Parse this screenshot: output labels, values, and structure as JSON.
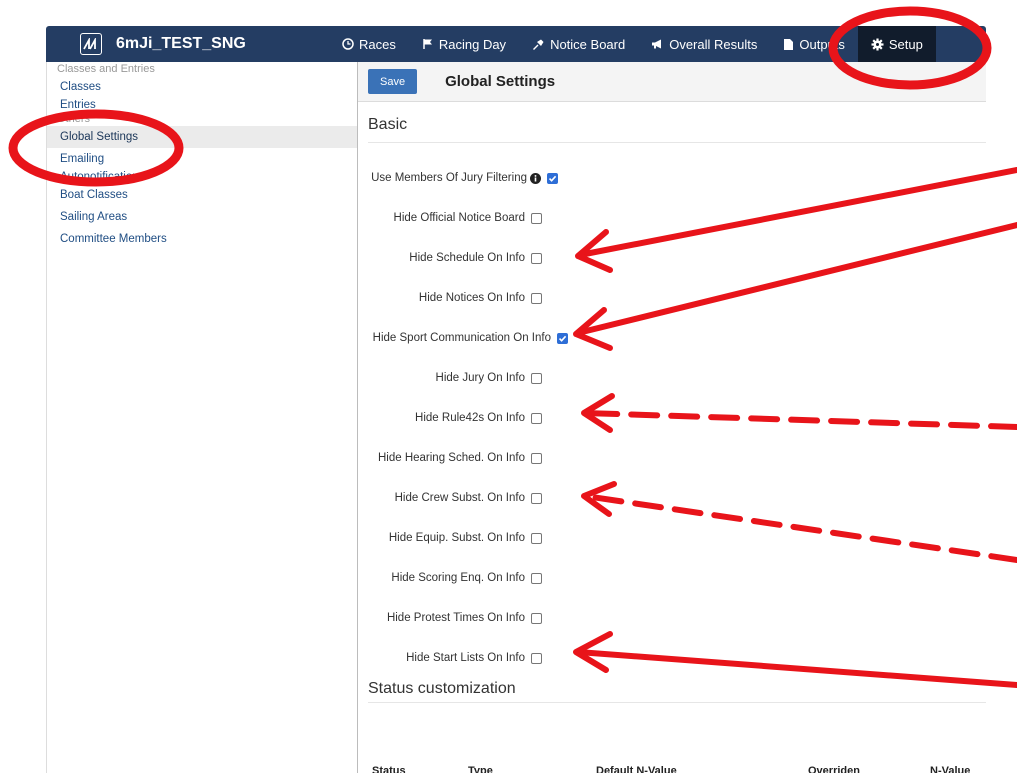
{
  "app": {
    "name": "6mJi_TEST_SNG"
  },
  "nav": {
    "items": [
      {
        "label": "Races",
        "icon": "clock-icon"
      },
      {
        "label": "Racing Day",
        "icon": "flag-icon"
      },
      {
        "label": "Notice Board",
        "icon": "pin-icon"
      },
      {
        "label": "Overall Results",
        "icon": "megaphone-icon"
      },
      {
        "label": "Outputs",
        "icon": "document-icon"
      },
      {
        "label": "Setup",
        "icon": "gear-icon"
      }
    ]
  },
  "sidebar": {
    "group1": "Classes and Entries",
    "classes": "Classes",
    "entries": "Entries",
    "group2": "Others",
    "global_settings": "Global Settings",
    "emailing": "Emailing",
    "autonotifications": "Autonotifications",
    "boat_classes": "Boat Classes",
    "sailing_areas": "Sailing Areas",
    "committee_members": "Committee Members"
  },
  "toolbar": {
    "save_label": "Save",
    "title": "Global Settings"
  },
  "basic": {
    "title": "Basic",
    "settings": [
      {
        "label": "Use Members Of Jury Filtering",
        "checked": true
      },
      {
        "label": "Hide Official Notice Board",
        "checked": false
      },
      {
        "label": "Hide Schedule On Info",
        "checked": false
      },
      {
        "label": "Hide Notices On Info",
        "checked": false
      },
      {
        "label": "Hide Sport Communication On Info",
        "checked": true
      },
      {
        "label": "Hide Jury On Info",
        "checked": false
      },
      {
        "label": "Hide Rule42s On Info",
        "checked": false
      },
      {
        "label": "Hide Hearing Sched. On Info",
        "checked": false
      },
      {
        "label": "Hide Crew Subst. On Info",
        "checked": false
      },
      {
        "label": "Hide Equip. Subst. On Info",
        "checked": false
      },
      {
        "label": "Hide Scoring Enq. On Info",
        "checked": false
      },
      {
        "label": "Hide Protest Times On Info",
        "checked": false
      },
      {
        "label": "Hide Start Lists On Info",
        "checked": false
      }
    ]
  },
  "status": {
    "title": "Status customization",
    "columns": [
      "Status",
      "Type",
      "Default N-Value",
      "Overriden",
      "N-Value"
    ]
  },
  "colors": {
    "navbar": "#243d63",
    "accent": "#3a72b7",
    "annotation": "#e8141a"
  }
}
